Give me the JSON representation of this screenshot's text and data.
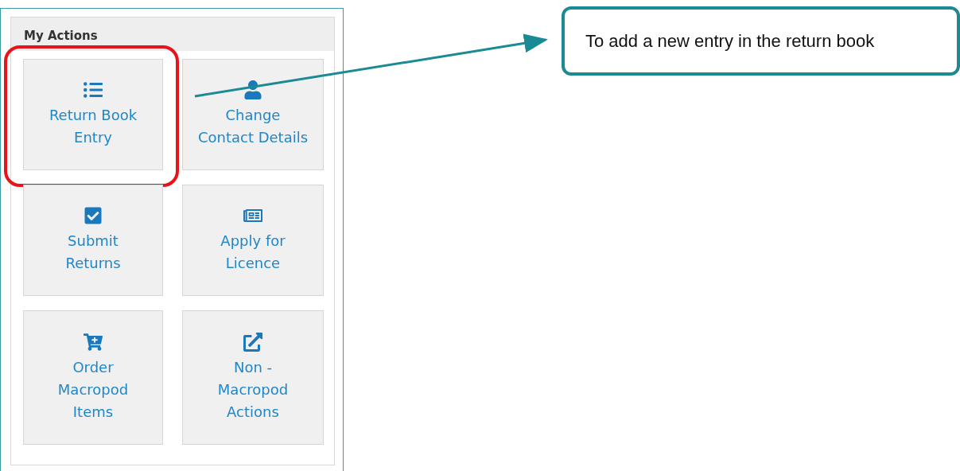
{
  "panel": {
    "title": "My Actions"
  },
  "actions": [
    {
      "label": "Return Book\nEntry",
      "kind": "list",
      "highlighted": true
    },
    {
      "label": "Change\nContact Details",
      "kind": "user",
      "highlighted": false
    },
    {
      "label": "Submit\nReturns",
      "kind": "check",
      "highlighted": false
    },
    {
      "label": "Apply for\nLicence",
      "kind": "news",
      "highlighted": false
    },
    {
      "label": "Order\nMacropod\nItems",
      "kind": "cart",
      "highlighted": false
    },
    {
      "label": "Non -\nMacropod\nActions",
      "kind": "external",
      "highlighted": false
    }
  ],
  "callout": {
    "text": "To add a new entry in the return book"
  }
}
